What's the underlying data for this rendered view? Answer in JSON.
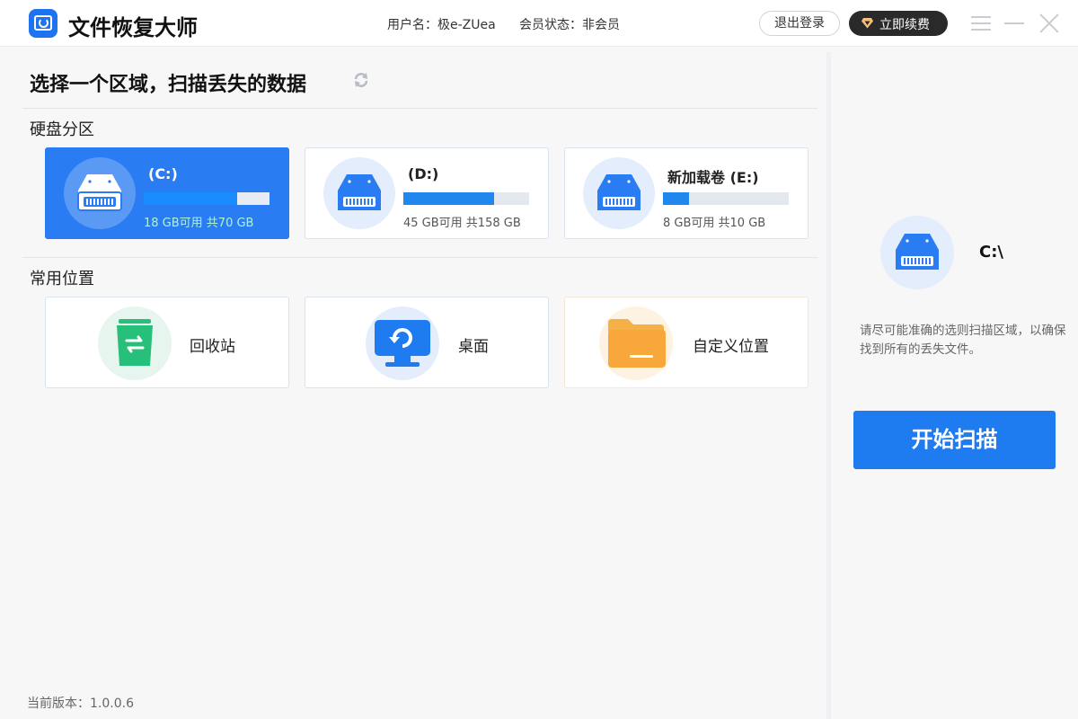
{
  "app": {
    "title": "文件恢复大师",
    "user_label": "用户名：极e-ZUea",
    "member_label": "会员状态：非会员",
    "logout_label": "退出登录",
    "renew_label": "立即续费"
  },
  "main": {
    "title": "选择一个区域，扫描丢失的数据",
    "partitions_label": "硬盘分区",
    "locations_label": "常用位置",
    "drives": [
      {
        "name": "(C:)",
        "space": "18 GB可用 共70 GB",
        "used_fraction": 0.74,
        "selected": true
      },
      {
        "name": "(D:)",
        "space": "45 GB可用 共158 GB",
        "used_fraction": 0.72,
        "selected": false
      },
      {
        "name": "新加载卷 (E:)",
        "space": "8 GB可用 共10 GB",
        "used_fraction": 0.21,
        "selected": false
      }
    ],
    "locations": [
      {
        "label": "回收站",
        "icon": "recycle-bin-icon"
      },
      {
        "label": "桌面",
        "icon": "desktop-icon"
      },
      {
        "label": "自定义位置",
        "icon": "folder-icon"
      }
    ],
    "version": "当前版本：1.0.0.6"
  },
  "side": {
    "selected_path": "C:\\",
    "hint": "请尽可能准确的选则扫描区域，以确保找到所有的丢失文件。",
    "start_label": "开始扫描"
  },
  "colors": {
    "accent": "#1e7bf0",
    "selected_card": "#2a7cf2",
    "recycle": "#27c07a",
    "folder": "#f8a83a"
  }
}
